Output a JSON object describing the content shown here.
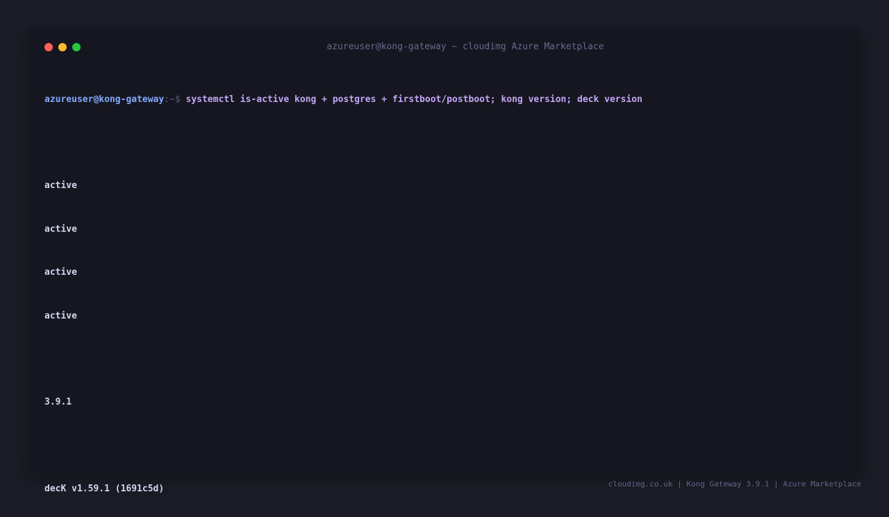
{
  "window": {
    "title": "azureuser@kong-gateway ~ cloudimg Azure Marketplace",
    "controls": {
      "close_color": "#ff5f57",
      "minimize_color": "#febc2e",
      "maximize_color": "#28c840"
    }
  },
  "terminal": {
    "prompt_user": "azureuser@kong-gateway",
    "prompt_path": ":~$",
    "command": "systemctl is-active kong + postgres + firstboot/postboot; kong version; deck version",
    "output": {
      "status_lines": [
        "active",
        "active",
        "active",
        "active"
      ],
      "kong_version": "3.9.1",
      "deck_version": "decK v1.59.1 (1691c5d)"
    }
  },
  "footer": {
    "text": "cloudimg.co.uk | Kong Gateway 3.9.1 | Azure Marketplace"
  },
  "colors": {
    "background": "#1b1c26",
    "terminal_bg": "#151620",
    "prompt_user": "#82aaff",
    "command": "#c3a6f5",
    "output": "#d4d7ee"
  }
}
